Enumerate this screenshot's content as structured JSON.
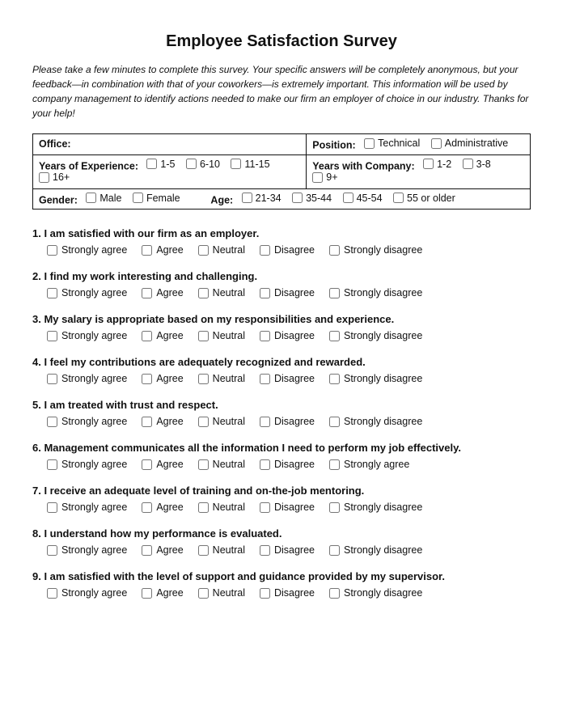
{
  "title": "Employee Satisfaction Survey",
  "intro": "Please take a few minutes to complete this survey. Your specific answers will be completely anonymous, but your feedback—in combination with that of your coworkers—is extremely important. This information will be used by company management to identify actions needed to make our firm an employer of choice in our industry. Thanks for your help!",
  "demographics": {
    "office_label": "Office:",
    "position_label": "Position:",
    "position_options": [
      "Technical",
      "Administrative"
    ],
    "years_exp_label": "Years of Experience:",
    "years_exp_options": [
      "1-5",
      "6-10",
      "11-15",
      "16+"
    ],
    "years_company_label": "Years with Company:",
    "years_company_options": [
      "1-2",
      "3-8",
      "9+"
    ],
    "gender_label": "Gender:",
    "gender_options": [
      "Male",
      "Female"
    ],
    "age_label": "Age:",
    "age_options": [
      "21-34",
      "35-44",
      "45-54",
      "55 or older"
    ]
  },
  "questions": [
    {
      "number": "1.",
      "text": "I am satisfied with our firm as an employer.",
      "options": [
        "Strongly agree",
        "Agree",
        "Neutral",
        "Disagree",
        "Strongly disagree"
      ]
    },
    {
      "number": "2.",
      "text": "I find my work interesting and challenging.",
      "options": [
        "Strongly agree",
        "Agree",
        "Neutral",
        "Disagree",
        "Strongly disagree"
      ]
    },
    {
      "number": "3.",
      "text": "My salary is appropriate based on my responsibilities and experience.",
      "options": [
        "Strongly agree",
        "Agree",
        "Neutral",
        "Disagree",
        "Strongly disagree"
      ]
    },
    {
      "number": "4.",
      "text": "I feel my contributions are adequately recognized and rewarded.",
      "options": [
        "Strongly agree",
        "Agree",
        "Neutral",
        "Disagree",
        "Strongly disagree"
      ]
    },
    {
      "number": "5.",
      "text": "I am treated with trust and respect.",
      "options": [
        "Strongly agree",
        "Agree",
        "Neutral",
        "Disagree",
        "Strongly disagree"
      ]
    },
    {
      "number": "6.",
      "text": "Management communicates all the information I need to perform my job effectively.",
      "options": [
        "Strongly agree",
        "Agree",
        "Neutral",
        "Disagree",
        "Strongly agree"
      ]
    },
    {
      "number": "7.",
      "text": " I receive an adequate level of training and on-the-job mentoring.",
      "options": [
        "Strongly agree",
        "Agree",
        "Neutral",
        "Disagree",
        "Strongly disagree"
      ]
    },
    {
      "number": "8.",
      "text": "I understand how my performance is evaluated.",
      "options": [
        "Strongly agree",
        "Agree",
        "Neutral",
        "Disagree",
        "Strongly disagree"
      ]
    },
    {
      "number": "9.",
      "text": "I am satisfied with the level of support and guidance provided by my supervisor.",
      "options": [
        "Strongly agree",
        "Agree",
        "Neutral",
        "Disagree",
        "Strongly disagree"
      ]
    }
  ]
}
